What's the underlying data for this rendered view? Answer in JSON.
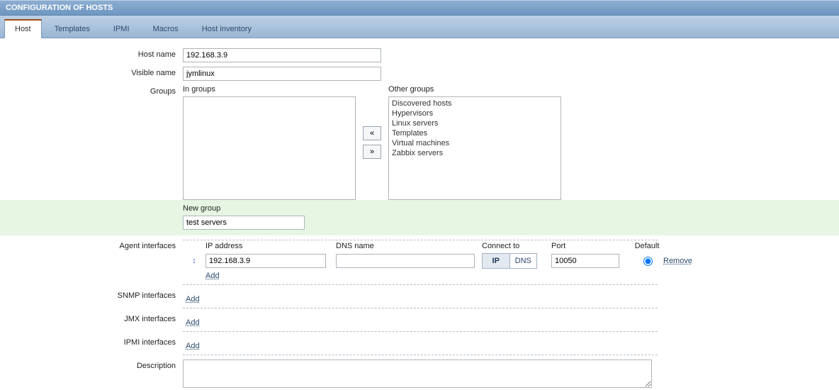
{
  "titlebar": "CONFIGURATION OF HOSTS",
  "tabs": {
    "host": "Host",
    "templates": "Templates",
    "ipmi": "IPMI",
    "macros": "Macros",
    "hostinv": "Host inventory"
  },
  "labels": {
    "host_name": "Host name",
    "visible_name": "Visible name",
    "groups": "Groups",
    "in_groups": "In groups",
    "other_groups": "Other groups",
    "new_group": "New group",
    "agent_ifaces": "Agent interfaces",
    "snmp_ifaces": "SNMP interfaces",
    "jmx_ifaces": "JMX interfaces",
    "ipmi_ifaces": "IPMI interfaces",
    "description": "Description"
  },
  "placeholders": {
    "host_name": ""
  },
  "values": {
    "host_name": "192.168.3.9",
    "visible_name": "jymlinux",
    "new_group": "test servers",
    "agent_ip": "192.168.3.9",
    "agent_dns": "",
    "agent_port": "10050",
    "connect_to": "IP"
  },
  "in_groups": [],
  "other_groups": [
    "Discovered hosts",
    "Hypervisors",
    "Linux servers",
    "Templates",
    "Virtual machines",
    "Zabbix servers"
  ],
  "iface_head": {
    "ip": "IP address",
    "dns": "DNS name",
    "connect": "Connect to",
    "port": "Port",
    "default": "Default"
  },
  "seg": {
    "ip": "IP",
    "dns": "DNS"
  },
  "links": {
    "add": "Add",
    "remove": "Remove"
  },
  "shuttle": {
    "left": "«",
    "right": "»"
  },
  "drag_glyph": "↕"
}
